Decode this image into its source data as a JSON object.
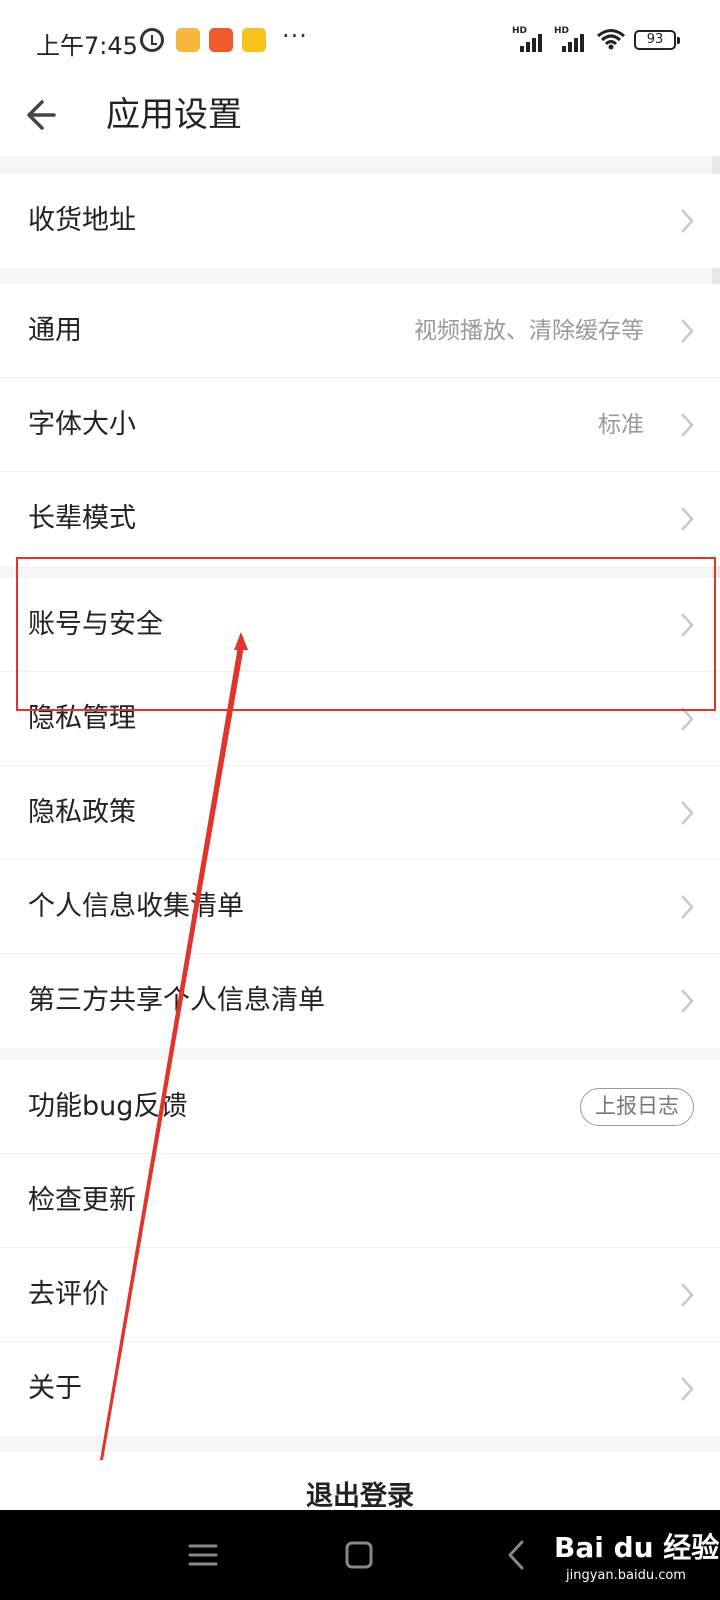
{
  "status_bar": {
    "time": "上午7:45",
    "dots": "···",
    "battery": "93"
  },
  "header": {
    "title": "应用设置"
  },
  "groups": [
    {
      "items": [
        {
          "label": "收货地址"
        }
      ]
    },
    {
      "items": [
        {
          "label": "通用",
          "value": "视频播放、清除缓存等"
        },
        {
          "label": "字体大小",
          "value": "标准"
        },
        {
          "label": "长辈模式"
        }
      ]
    },
    {
      "items": [
        {
          "label": "账号与安全"
        },
        {
          "label": "隐私管理"
        },
        {
          "label": "隐私政策"
        },
        {
          "label": "个人信息收集清单"
        },
        {
          "label": "第三方共享个人信息清单"
        }
      ]
    },
    {
      "items": [
        {
          "label": "功能bug反馈",
          "pill": "上报日志"
        },
        {
          "label": "检查更新"
        },
        {
          "label": "去评价"
        },
        {
          "label": "关于"
        }
      ]
    }
  ],
  "logout": {
    "label": "退出登录"
  },
  "watermark": {
    "brand": "Bai du 经验",
    "url": "jingyan.baidu.com"
  },
  "colors": {
    "annotation": "#e2342a",
    "chevron": "#c8c8c8",
    "secondary_text": "#999999"
  }
}
